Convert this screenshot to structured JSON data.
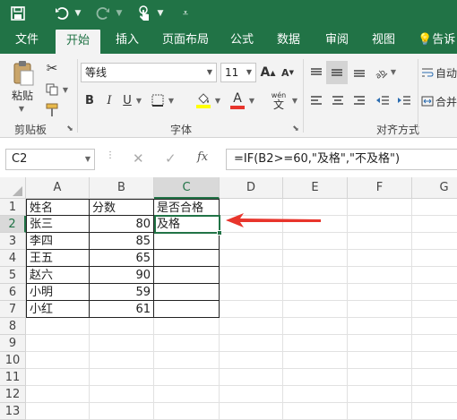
{
  "tabs": [
    "文件",
    "开始",
    "插入",
    "页面布局",
    "公式",
    "数据",
    "审阅",
    "视图",
    "告诉"
  ],
  "ribbon": {
    "paste_label": "粘贴",
    "clipboard_label": "剪贴板",
    "font_label": "字体",
    "alignment_label": "对齐方式",
    "font_name": "等线",
    "font_size": "11",
    "bold": "B",
    "italic": "I",
    "underline": "U",
    "font_grow": "A",
    "font_shrink": "A",
    "font_color": "A",
    "wen": "wén",
    "wen_char": "文",
    "wrap_text": "自动",
    "merge": "合并"
  },
  "formula_bar": {
    "name_box": "C2",
    "formula": "=IF(B2>=60,\"及格\",\"不及格\")",
    "fx": "fx"
  },
  "columns": [
    "A",
    "B",
    "C",
    "D",
    "E",
    "F",
    "G"
  ],
  "rows": [
    "1",
    "2",
    "3",
    "4",
    "5",
    "6",
    "7",
    "8",
    "9",
    "10",
    "11",
    "12",
    "13"
  ],
  "table": {
    "headers": [
      "姓名",
      "分数",
      "是否合格"
    ],
    "rows": [
      [
        "张三",
        "80",
        "及格"
      ],
      [
        "李四",
        "85",
        ""
      ],
      [
        "王五",
        "65",
        ""
      ],
      [
        "赵六",
        "90",
        ""
      ],
      [
        "小明",
        "59",
        ""
      ],
      [
        "小红",
        "61",
        ""
      ]
    ]
  },
  "colors": {
    "brand": "#217346",
    "arrow": "#e8352c"
  }
}
